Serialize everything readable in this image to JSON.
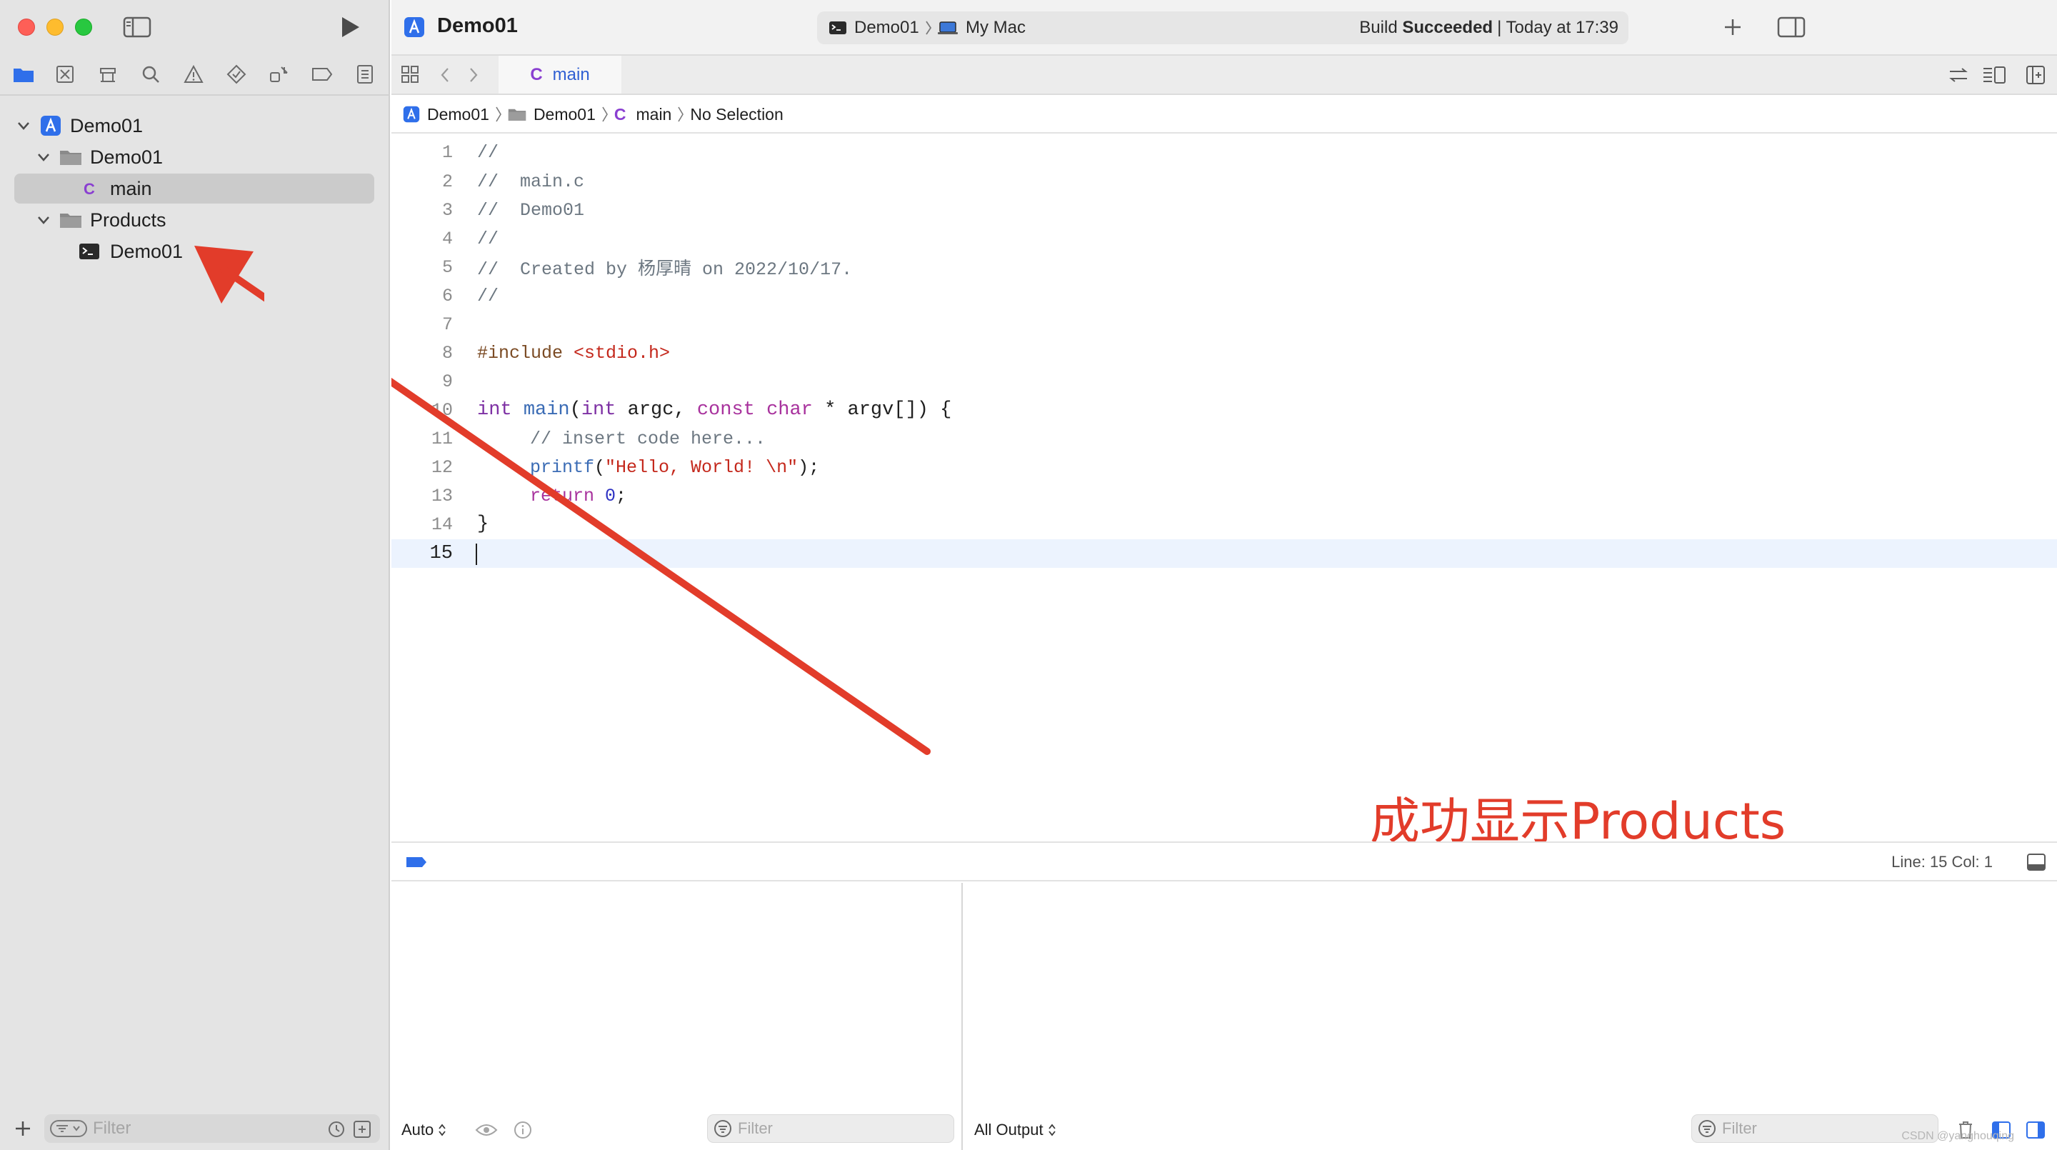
{
  "window": {
    "project_title": "Demo01",
    "scheme": "Demo01",
    "destination": "My Mac",
    "build_status_prefix": "Build ",
    "build_status_word": "Succeeded",
    "build_time": "| Today at 17:39"
  },
  "navigator": {
    "tree": [
      {
        "label": "Demo01",
        "icon": "project-icon"
      },
      {
        "label": "Demo01",
        "icon": "folder-icon"
      },
      {
        "label": "main",
        "icon": "c-file-icon"
      },
      {
        "label": "Products",
        "icon": "folder-icon"
      },
      {
        "label": "Demo01",
        "icon": "terminal-icon"
      }
    ],
    "filter_placeholder": "Filter"
  },
  "editor": {
    "tab_label": "main",
    "tab_letter": "C",
    "breadcrumb": [
      "Demo01",
      "Demo01",
      "main",
      "No Selection"
    ],
    "line_numbers": [
      "1",
      "2",
      "3",
      "4",
      "5",
      "6",
      "7",
      "8",
      "9",
      "10",
      "11",
      "12",
      "13",
      "14",
      "15"
    ],
    "code": {
      "l1": "//",
      "l2": "//  main.c",
      "l3": "//  Demo01",
      "l4": "//",
      "l5": "//  Created by 杨厚晴 on 2022/10/17.",
      "l6": "//",
      "l8a": "#include ",
      "l8b": "<stdio.h>",
      "l10_int": "int",
      "l10_main": "main",
      "l10_paren": "(",
      "l10_int2": "int",
      "l10_argc": " argc, ",
      "l10_const": "const",
      "l10_char": "char",
      "l10_rest": " * argv[]) {",
      "l11": "// insert code here...",
      "l12_fn": "printf",
      "l12_open": "(",
      "l12_str": "\"Hello, World! \\n\"",
      "l12_close": ");",
      "l13_kw": "return",
      "l13_num": "0",
      "l13_end": ";",
      "l14": "}"
    },
    "cursor_info": "Line: 15  Col: 1"
  },
  "annotation": {
    "text": "成功显示Products",
    "color": "#e23c2a"
  },
  "console": {
    "scope_label": "Auto",
    "filter_placeholder": "Filter",
    "output_label": "All Output",
    "output_filter_placeholder": "Filter",
    "watermark": "CSDN @yanghouqing"
  },
  "colors": {
    "accent": "#2f6fea",
    "sidebar_bg": "#e4e4e4",
    "selected_row": "#cbcbcb",
    "current_line": "#ecf3fe"
  }
}
